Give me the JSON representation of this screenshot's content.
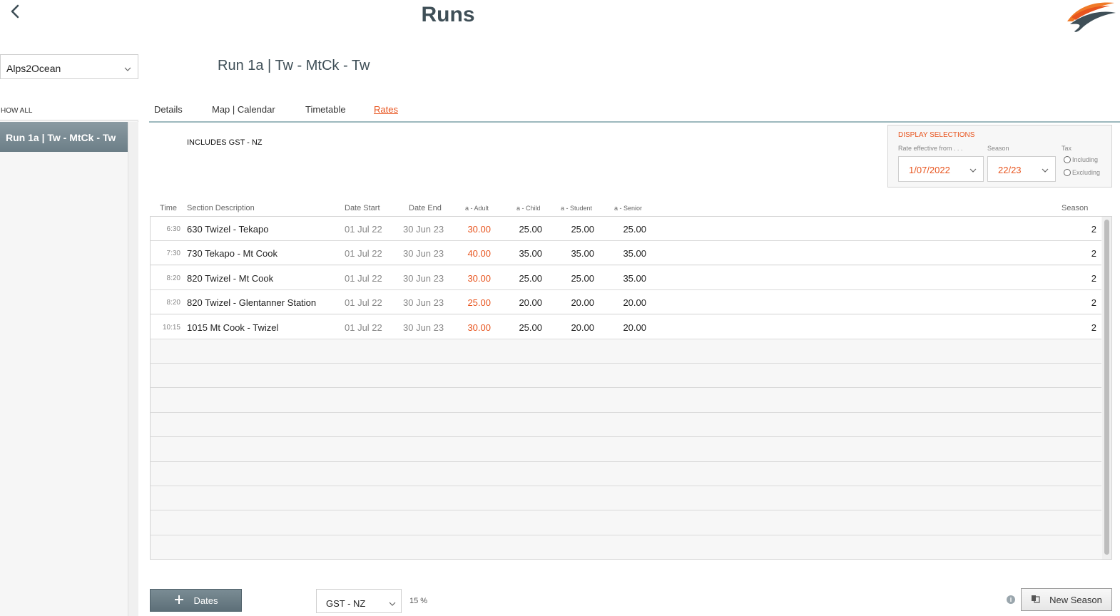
{
  "header": {
    "title": "Runs"
  },
  "sidebar": {
    "brand_select_value": "Alps2Ocean",
    "show_all_label": "HOW ALL",
    "selected_run": "Run 1a | Tw - MtCk - Tw"
  },
  "main": {
    "run_title": "Run 1a | Tw - MtCk - Tw",
    "tabs": [
      {
        "label": "Details"
      },
      {
        "label": "Map | Calendar"
      },
      {
        "label": "Timetable"
      },
      {
        "label": "Rates",
        "active": true
      }
    ],
    "tax_note": "INCLUDES GST - NZ"
  },
  "display_selections": {
    "title": "DISPLAY SELECTIONS",
    "rate_label": "Rate effective from . . .",
    "rate_value": "1/07/2022",
    "season_label": "Season",
    "season_value": "22/23",
    "tax_label": "Tax",
    "tax_options": [
      "Including",
      "Excluding"
    ]
  },
  "table": {
    "headers": {
      "time": "Time",
      "section": "Section Description",
      "date_start": "Date Start",
      "date_end": "Date End",
      "adult": "a - Adult",
      "child": "a - Child",
      "student": "a - Student",
      "senior": "a - Senior",
      "season": "Season"
    },
    "rows": [
      {
        "time": "6:30",
        "section": "630 Twizel - Tekapo",
        "date_start": "01 Jul 22",
        "date_end": "30 Jun 23",
        "adult": "30.00",
        "child": "25.00",
        "student": "25.00",
        "senior": "25.00",
        "season": "2"
      },
      {
        "time": "7:30",
        "section": "730 Tekapo - Mt Cook",
        "date_start": "01 Jul 22",
        "date_end": "30 Jun 23",
        "adult": "40.00",
        "child": "35.00",
        "student": "35.00",
        "senior": "35.00",
        "season": "2"
      },
      {
        "time": "8:20",
        "section": "820 Twizel - Mt Cook",
        "date_start": "01 Jul 22",
        "date_end": "30 Jun 23",
        "adult": "30.00",
        "child": "25.00",
        "student": "25.00",
        "senior": "35.00",
        "season": "2"
      },
      {
        "time": "8:20",
        "section": "820 Twizel - Glentanner Station",
        "date_start": "01 Jul 22",
        "date_end": "30 Jun 23",
        "adult": "25.00",
        "child": "20.00",
        "student": "20.00",
        "senior": "20.00",
        "season": "2"
      },
      {
        "time": "10:15",
        "section": "1015 Mt Cook - Twizel",
        "date_start": "01 Jul 22",
        "date_end": "30 Jun 23",
        "adult": "30.00",
        "child": "25.00",
        "student": "20.00",
        "senior": "20.00",
        "season": "2"
      }
    ]
  },
  "footer": {
    "dates_button": "Dates",
    "gst_select_value": "GST - NZ",
    "gst_percent": "15 %",
    "info_icon": "i",
    "new_season_button": "New Season"
  },
  "colors": {
    "accent": "#e8541e",
    "header_slate": "#3f4f57",
    "button_slate": "#6c7e87"
  }
}
